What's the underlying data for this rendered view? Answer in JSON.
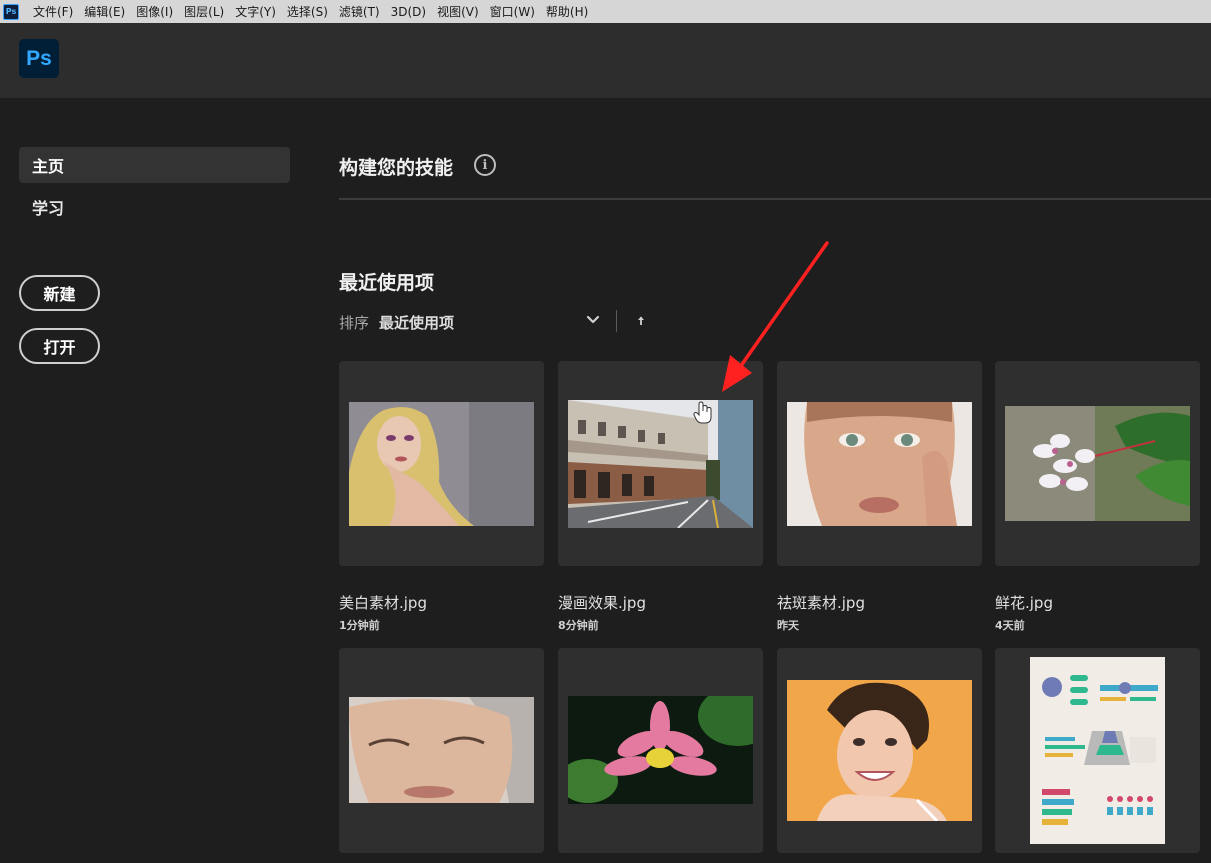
{
  "menubar": {
    "app_icon": "Ps",
    "items": [
      "文件(F)",
      "编辑(E)",
      "图像(I)",
      "图层(L)",
      "文字(Y)",
      "选择(S)",
      "滤镜(T)",
      "3D(D)",
      "视图(V)",
      "窗口(W)",
      "帮助(H)"
    ]
  },
  "header": {
    "logo": "Ps"
  },
  "sidebar": {
    "nav": [
      {
        "label": "主页",
        "active": true
      },
      {
        "label": "学习",
        "active": false
      }
    ],
    "new_button": "新建",
    "open_button": "打开"
  },
  "main": {
    "skills_title": "构建您的技能",
    "info_icon": "i",
    "recent_title": "最近使用项",
    "sort_label": "排序",
    "sort_value": "最近使用项",
    "files": [
      {
        "name": "美白素材.jpg",
        "time": "1分钟前"
      },
      {
        "name": "漫画效果.jpg",
        "time": "8分钟前"
      },
      {
        "name": "祛斑素材.jpg",
        "time": "昨天"
      },
      {
        "name": "鲜花.jpg",
        "time": "4天前"
      },
      {
        "name": "",
        "time": ""
      },
      {
        "name": "",
        "time": ""
      },
      {
        "name": "",
        "time": ""
      },
      {
        "name": "",
        "time": ""
      }
    ]
  },
  "colors": {
    "background": "#1e1e1e",
    "header": "#2d2d2d",
    "menubar": "#d6d6d6",
    "card": "#2f2f2f",
    "ps_blue": "#31a8ff",
    "annotation": "#ff2020"
  }
}
